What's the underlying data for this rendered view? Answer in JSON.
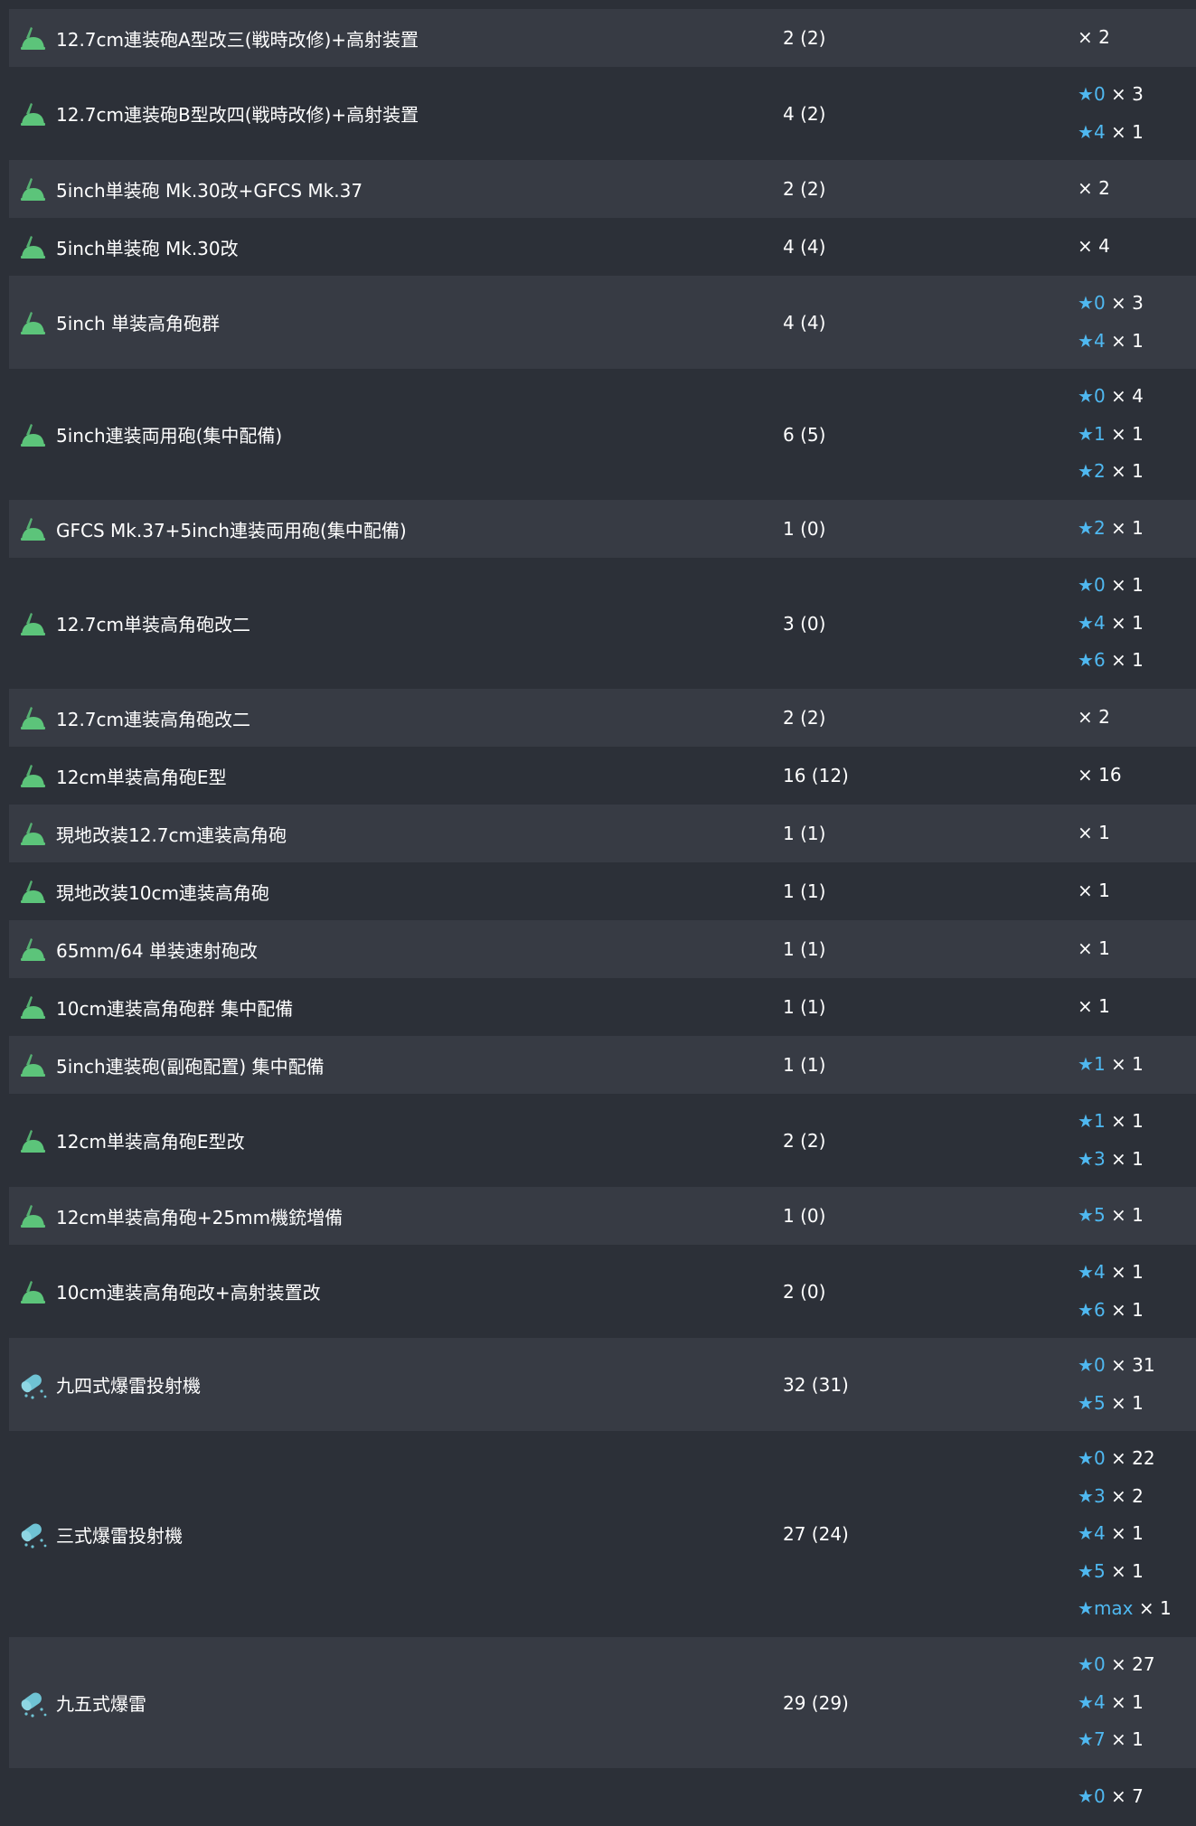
{
  "colors": {
    "row_odd": "#373b44",
    "row_even": "#2c3038",
    "star": "#4fb8f0",
    "gun_icon": "#5cc47a",
    "aircraft_icon": "#6fc3d4"
  },
  "rows": [
    {
      "icon": "gun-icon",
      "name": "12.7cm連装砲A型改三(戦時改修)+高射装置",
      "count": "2 (2)",
      "stars": [
        {
          "level": "",
          "qty": "× 2"
        }
      ]
    },
    {
      "icon": "gun-icon",
      "name": "12.7cm連装砲B型改四(戦時改修)+高射装置",
      "count": "4 (2)",
      "stars": [
        {
          "level": "0",
          "qty": "× 3"
        },
        {
          "level": "4",
          "qty": "× 1"
        }
      ]
    },
    {
      "icon": "gun-icon",
      "name": "5inch単装砲 Mk.30改+GFCS Mk.37",
      "count": "2 (2)",
      "stars": [
        {
          "level": "",
          "qty": "× 2"
        }
      ]
    },
    {
      "icon": "gun-icon",
      "name": "5inch単装砲 Mk.30改",
      "count": "4 (4)",
      "stars": [
        {
          "level": "",
          "qty": "× 4"
        }
      ]
    },
    {
      "icon": "gun-icon",
      "name": "5inch 単装高角砲群",
      "count": "4 (4)",
      "stars": [
        {
          "level": "0",
          "qty": "× 3"
        },
        {
          "level": "4",
          "qty": "× 1"
        }
      ]
    },
    {
      "icon": "gun-icon",
      "name": "5inch連装両用砲(集中配備)",
      "count": "6 (5)",
      "stars": [
        {
          "level": "0",
          "qty": "× 4"
        },
        {
          "level": "1",
          "qty": "× 1"
        },
        {
          "level": "2",
          "qty": "× 1"
        }
      ]
    },
    {
      "icon": "gun-icon",
      "name": "GFCS Mk.37+5inch連装両用砲(集中配備)",
      "count": "1 (0)",
      "stars": [
        {
          "level": "2",
          "qty": "× 1"
        }
      ]
    },
    {
      "icon": "gun-icon",
      "name": "12.7cm単装高角砲改二",
      "count": "3 (0)",
      "stars": [
        {
          "level": "0",
          "qty": "× 1"
        },
        {
          "level": "4",
          "qty": "× 1"
        },
        {
          "level": "6",
          "qty": "× 1"
        }
      ]
    },
    {
      "icon": "gun-icon",
      "name": "12.7cm連装高角砲改二",
      "count": "2 (2)",
      "stars": [
        {
          "level": "",
          "qty": "× 2"
        }
      ]
    },
    {
      "icon": "gun-icon",
      "name": "12cm単装高角砲E型",
      "count": "16 (12)",
      "stars": [
        {
          "level": "",
          "qty": "× 16"
        }
      ]
    },
    {
      "icon": "gun-icon",
      "name": "現地改装12.7cm連装高角砲",
      "count": "1 (1)",
      "stars": [
        {
          "level": "",
          "qty": "× 1"
        }
      ]
    },
    {
      "icon": "gun-icon",
      "name": "現地改装10cm連装高角砲",
      "count": "1 (1)",
      "stars": [
        {
          "level": "",
          "qty": "× 1"
        }
      ]
    },
    {
      "icon": "gun-icon",
      "name": "65mm/64 単装速射砲改",
      "count": "1 (1)",
      "stars": [
        {
          "level": "",
          "qty": "× 1"
        }
      ]
    },
    {
      "icon": "gun-icon",
      "name": "10cm連装高角砲群 集中配備",
      "count": "1 (1)",
      "stars": [
        {
          "level": "",
          "qty": "× 1"
        }
      ]
    },
    {
      "icon": "gun-icon",
      "name": "5inch連装砲(副砲配置) 集中配備",
      "count": "1 (1)",
      "stars": [
        {
          "level": "1",
          "qty": "× 1"
        }
      ]
    },
    {
      "icon": "gun-icon",
      "name": "12cm単装高角砲E型改",
      "count": "2 (2)",
      "stars": [
        {
          "level": "1",
          "qty": "× 1"
        },
        {
          "level": "3",
          "qty": "× 1"
        }
      ]
    },
    {
      "icon": "gun-icon",
      "name": "12cm単装高角砲+25mm機銃増備",
      "count": "1 (0)",
      "stars": [
        {
          "level": "5",
          "qty": "× 1"
        }
      ]
    },
    {
      "icon": "gun-icon",
      "name": "10cm連装高角砲改+高射装置改",
      "count": "2 (0)",
      "stars": [
        {
          "level": "4",
          "qty": "× 1"
        },
        {
          "level": "6",
          "qty": "× 1"
        }
      ]
    },
    {
      "icon": "depth-charge-projector-icon",
      "name": "九四式爆雷投射機",
      "count": "32 (31)",
      "stars": [
        {
          "level": "0",
          "qty": "× 31"
        },
        {
          "level": "5",
          "qty": "× 1"
        }
      ]
    },
    {
      "icon": "depth-charge-projector-icon",
      "name": "三式爆雷投射機",
      "count": "27 (24)",
      "stars": [
        {
          "level": "0",
          "qty": "× 22"
        },
        {
          "level": "3",
          "qty": "× 2"
        },
        {
          "level": "4",
          "qty": "× 1"
        },
        {
          "level": "5",
          "qty": "× 1"
        },
        {
          "level": "max",
          "qty": "× 1"
        }
      ]
    },
    {
      "icon": "depth-charge-projector-icon",
      "name": "九五式爆雷",
      "count": "29 (29)",
      "stars": [
        {
          "level": "0",
          "qty": "× 27"
        },
        {
          "level": "4",
          "qty": "× 1"
        },
        {
          "level": "7",
          "qty": "× 1"
        }
      ]
    },
    {
      "icon": "",
      "name": "",
      "count": "",
      "stars": [
        {
          "level": "0",
          "qty": "× 7"
        }
      ]
    }
  ]
}
